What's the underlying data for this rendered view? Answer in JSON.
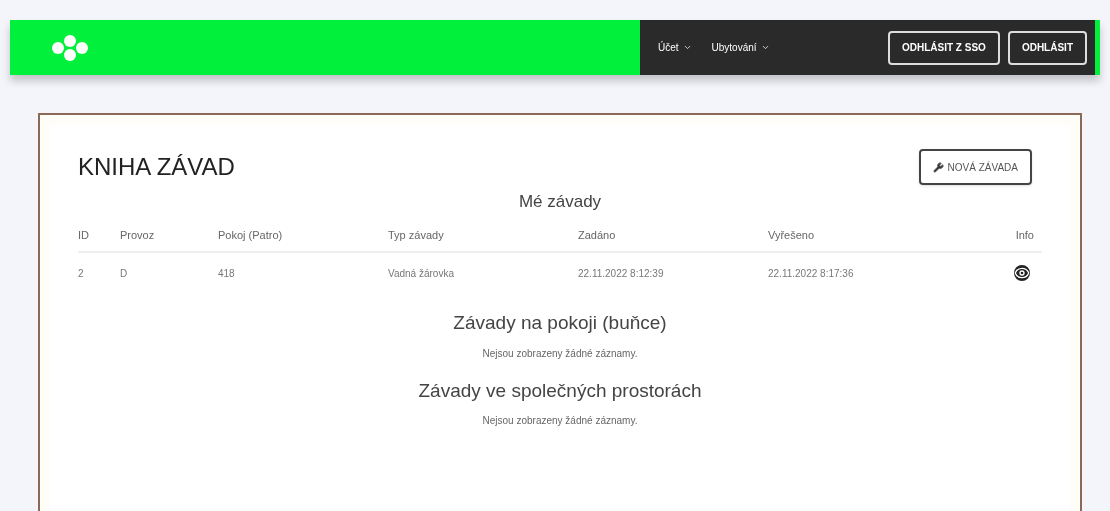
{
  "navbar": {
    "menus": [
      {
        "label": "Účet"
      },
      {
        "label": "Ubytování"
      }
    ],
    "buttons": [
      "ODHLÁSIT Z SSO",
      "ODHLÁSIT"
    ]
  },
  "page": {
    "title": "KNIHA ZÁVAD",
    "new_button": "NOVÁ ZÁVADA",
    "sections": [
      {
        "kind": "table",
        "heading": "Mé závady",
        "columns": [
          "ID",
          "Provoz",
          "Pokoj (Patro)",
          "Typ závady",
          "Zadáno",
          "Vyřešeno",
          "Info"
        ],
        "rows": [
          [
            "2",
            "D",
            "418",
            "Vadná žárovka",
            "22.11.2022 8:12:39",
            "22.11.2022 8:17:36"
          ]
        ]
      },
      {
        "kind": "empty",
        "heading": "Závady na pokoji (buňce)",
        "message": "Nejsou zobrazeny žádné záznamy."
      },
      {
        "kind": "empty",
        "heading": "Závady ve společných prostorách",
        "message": "Nejsou zobrazeny žádné záznamy."
      }
    ]
  }
}
